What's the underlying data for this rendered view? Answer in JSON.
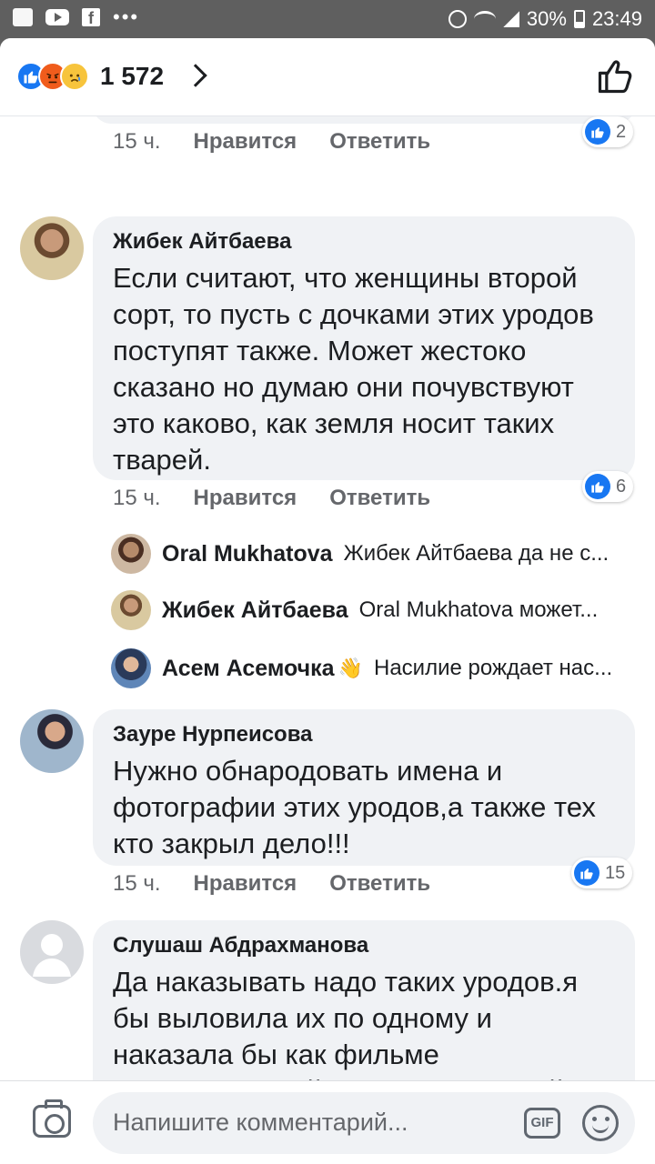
{
  "status_bar": {
    "battery": "30%",
    "time": "23:49"
  },
  "header": {
    "reaction_count": "1 572"
  },
  "comments": [
    {
      "time": "15 ч.",
      "like_label": "Нравится",
      "reply_label": "Ответить",
      "reactions": "2"
    },
    {
      "author": "Жибек Айтбаева",
      "text": "Если  считают, что женщины второй сорт, то пусть с дочками этих уродов поступят также. Может жестоко сказано но думаю они почувствуют это каково, как земля носит таких тварей.",
      "time": "15 ч.",
      "like_label": "Нравится",
      "reply_label": "Ответить",
      "reactions": "6",
      "replies": [
        {
          "author": "Oral Mukhatova",
          "text": "Жибек Айтбаева да не с..."
        },
        {
          "author": "Жибек Айтбаева",
          "text": "Oral Mukhatova может..."
        },
        {
          "author": "Асем Асемочка",
          "emoji": "👋",
          "text": "Насилие рождает нас..."
        }
      ]
    },
    {
      "author": "Зауре Нурпеисова",
      "text": "Нужно обнародовать имена и фотографии этих уродов,а также тех кто закрыл дело!!!",
      "time": "15 ч.",
      "like_label": "Нравится",
      "reply_label": "Ответить",
      "reactions": "15"
    },
    {
      "author": "Слушаш Абдрахманова",
      "text": "Да наказывать надо таких уродов.я бы выловила их по одному и наказала бы как фильме Ворошиловский стрелок.тогда поймут как эти твари ходят ещё в"
    }
  ],
  "composer": {
    "placeholder": "Напишите комментарий...",
    "gif_label": "GIF"
  },
  "colors": {
    "accent": "#1877f2",
    "bubble": "#f0f2f5",
    "secondary_text": "#65676b"
  }
}
